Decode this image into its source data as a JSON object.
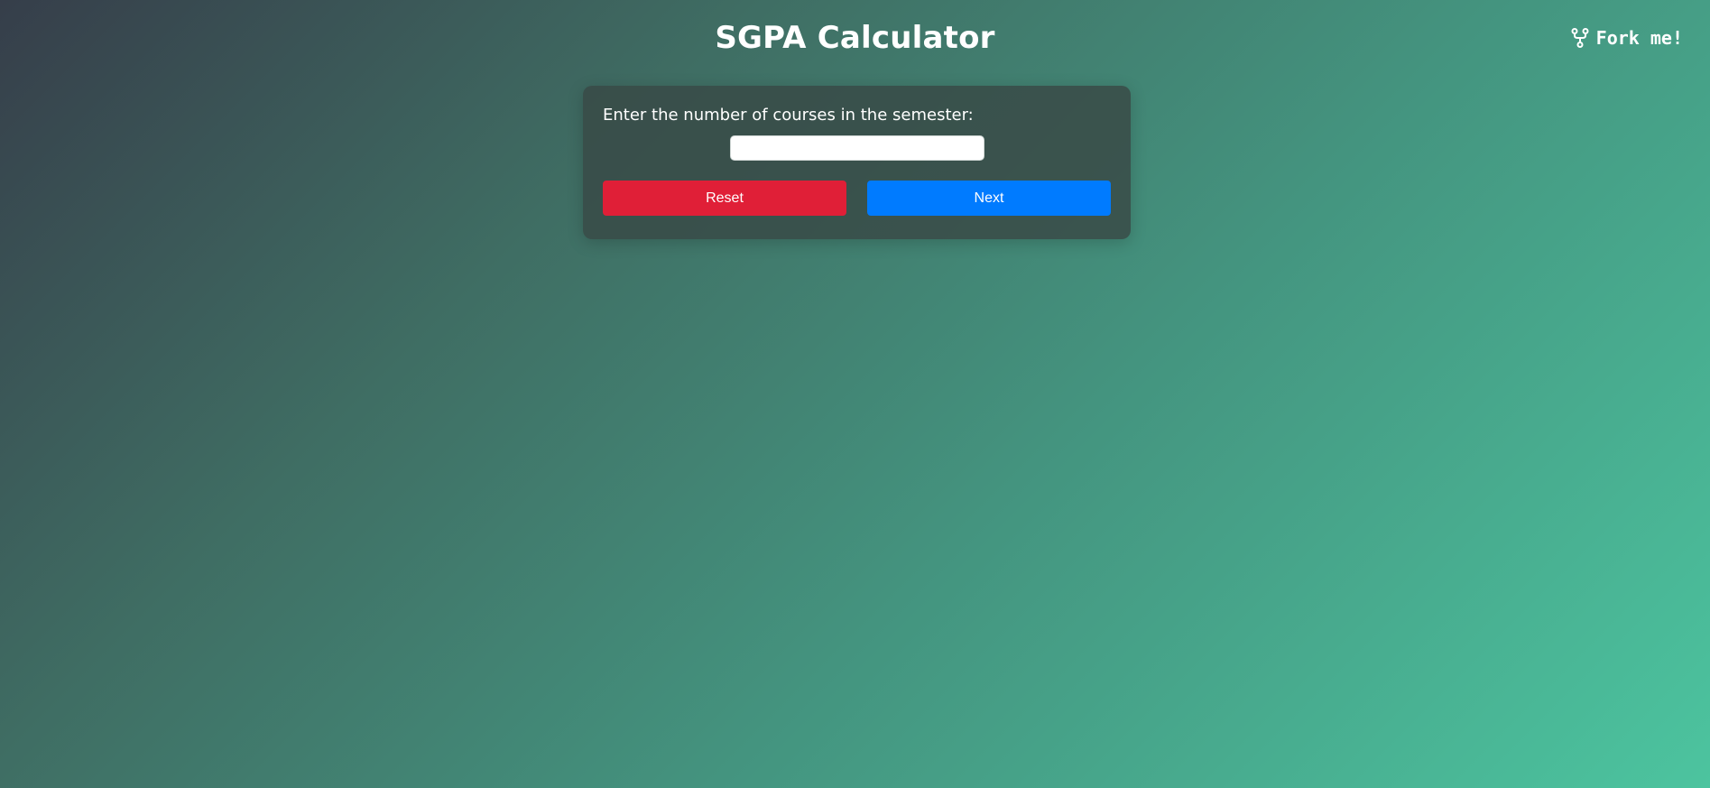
{
  "header": {
    "title": "SGPA Calculator",
    "fork_label": "Fork me!",
    "fork_icon": "git-fork-icon"
  },
  "form": {
    "prompt": "Enter the number of courses in the semester:",
    "courses_value": "",
    "reset_label": "Reset",
    "next_label": "Next"
  },
  "colors": {
    "reset_button": "#e01f37",
    "next_button": "#007bff",
    "background_start": "#363e4a",
    "background_end": "#4cc49f"
  }
}
